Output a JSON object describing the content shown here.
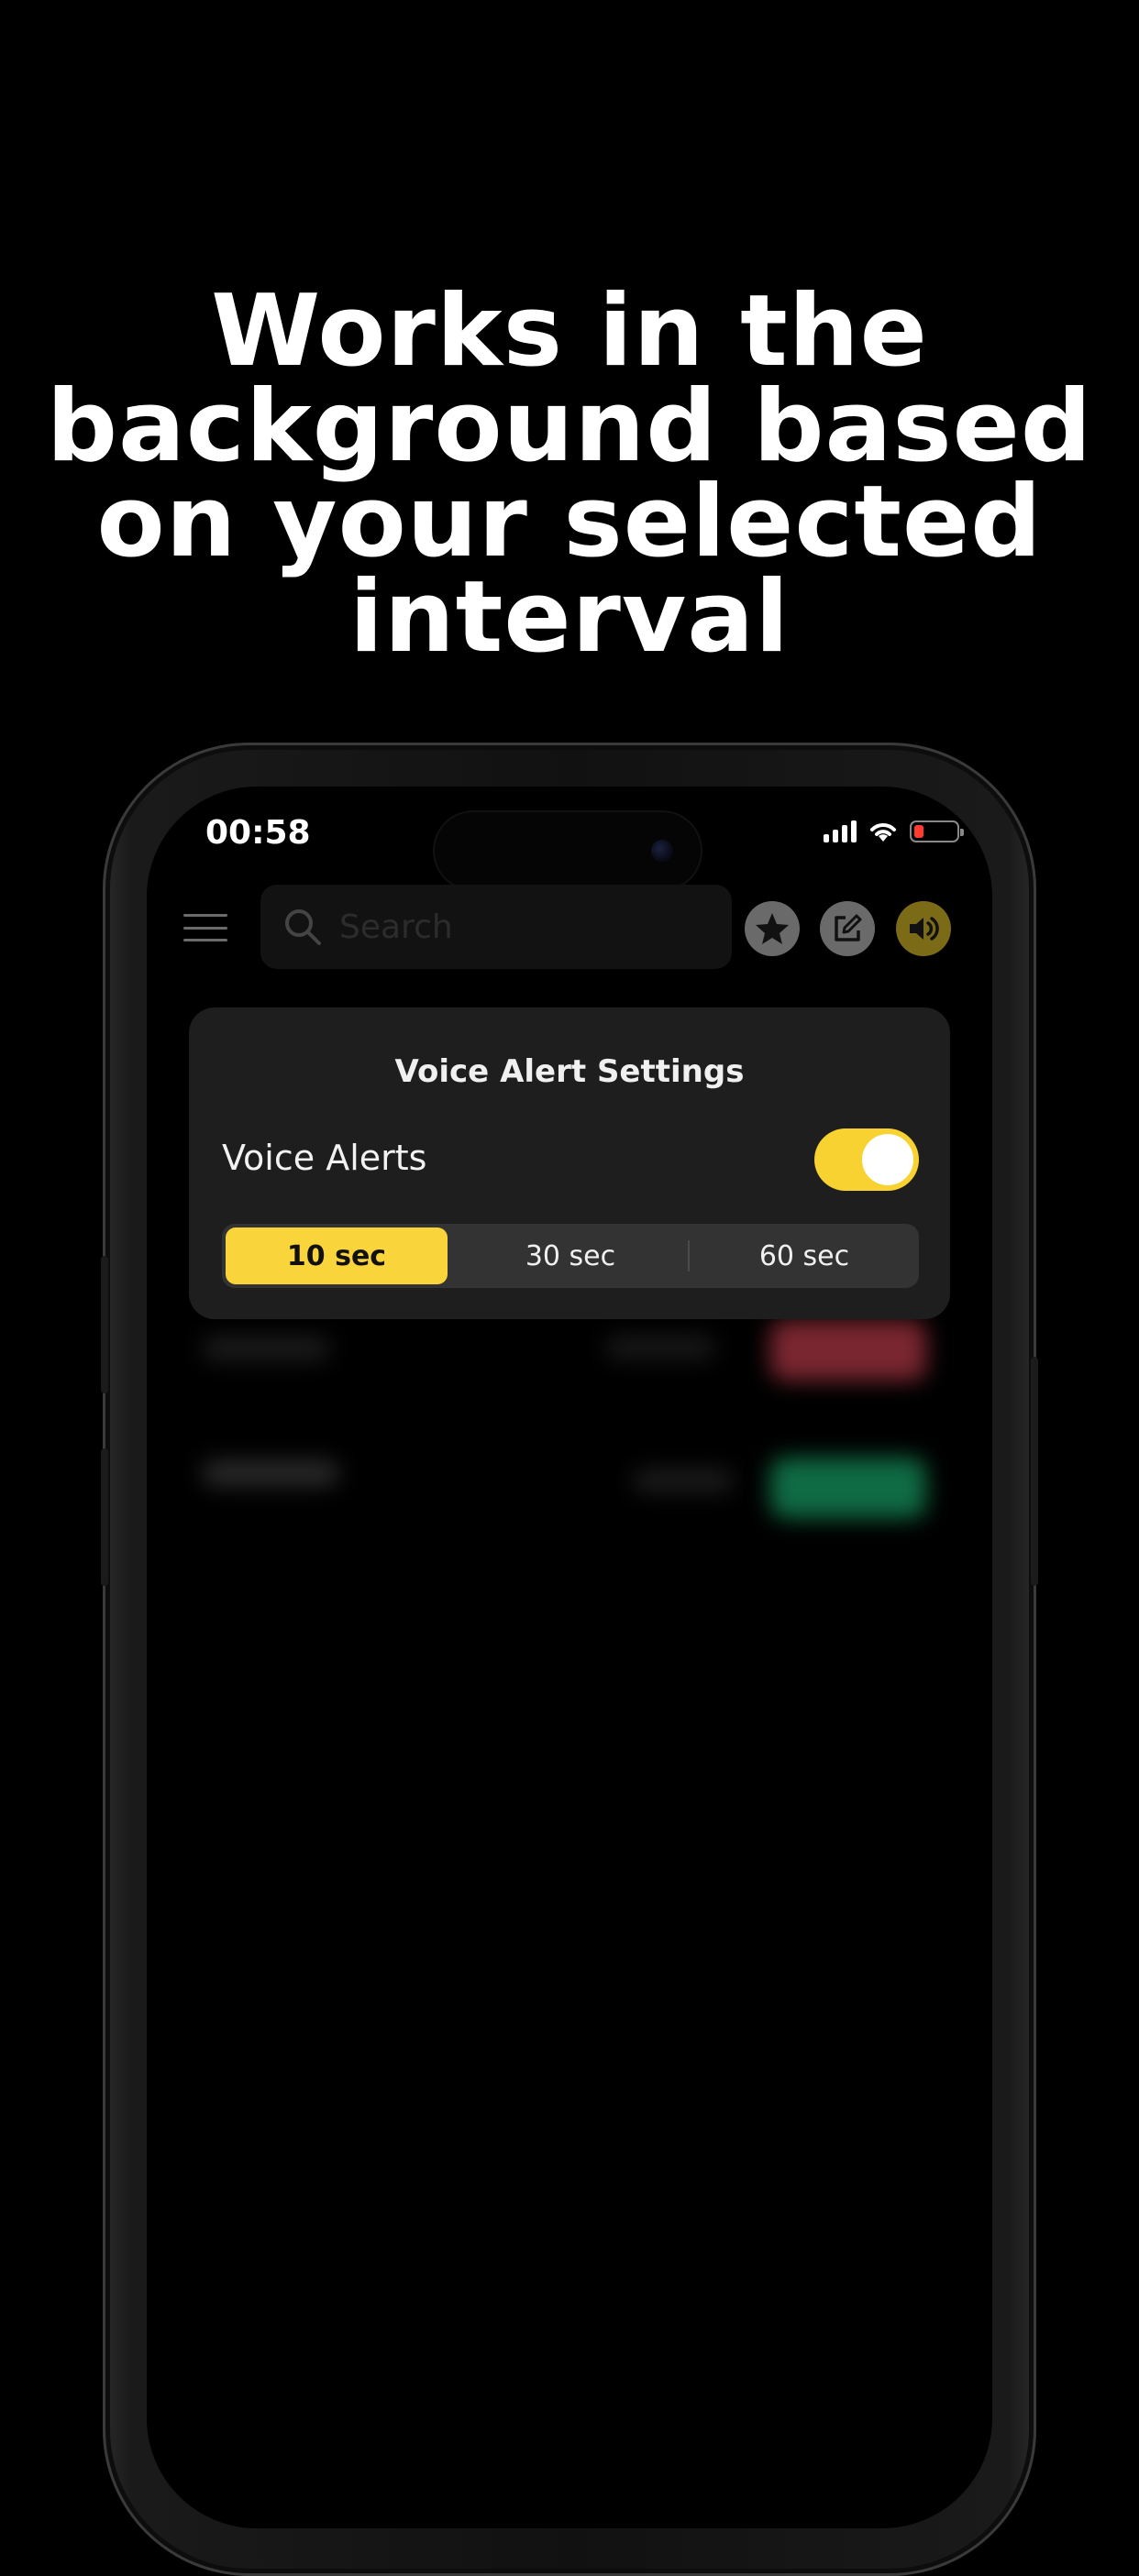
{
  "headline": {
    "lines": [
      "Works in the",
      "background based",
      "on your selected",
      "interval"
    ]
  },
  "status_bar": {
    "time": "00:58",
    "battery_color": "#ff3b30"
  },
  "navbar": {
    "menu_icon": "hamburger-icon",
    "search_placeholder": "Search",
    "buttons": [
      "star-icon",
      "edit-icon",
      "speaker-icon"
    ],
    "sound_button_color": "#7c6b16"
  },
  "modal": {
    "title": "Voice Alert Settings",
    "toggle_label": "Voice Alerts",
    "toggle_on": true,
    "accent_color": "#f9d43a",
    "intervals": [
      "10 sec",
      "30 sec",
      "60 sec"
    ],
    "selected_interval": "10 sec"
  }
}
